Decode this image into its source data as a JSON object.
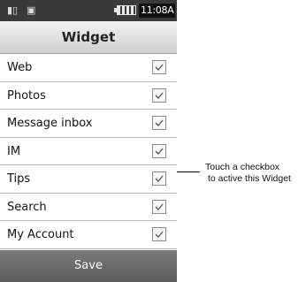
{
  "status_bar": {
    "signal_icon": "signal-icon",
    "message_icon": "message-icon",
    "battery_icon": "battery-icon",
    "time": "11:08A"
  },
  "header": {
    "title": "Widget"
  },
  "widget_list": {
    "items": [
      {
        "label": "Web",
        "checked": true
      },
      {
        "label": "Photos",
        "checked": true
      },
      {
        "label": "Message inbox",
        "checked": true
      },
      {
        "label": "IM",
        "checked": true
      },
      {
        "label": "Tips",
        "checked": true
      },
      {
        "label": "Search",
        "checked": true
      },
      {
        "label": "My Account",
        "checked": true
      }
    ]
  },
  "footer": {
    "save_label": "Save"
  },
  "callout": {
    "line1": "Touch a checkbox",
    "line2": "to active this Widget"
  }
}
